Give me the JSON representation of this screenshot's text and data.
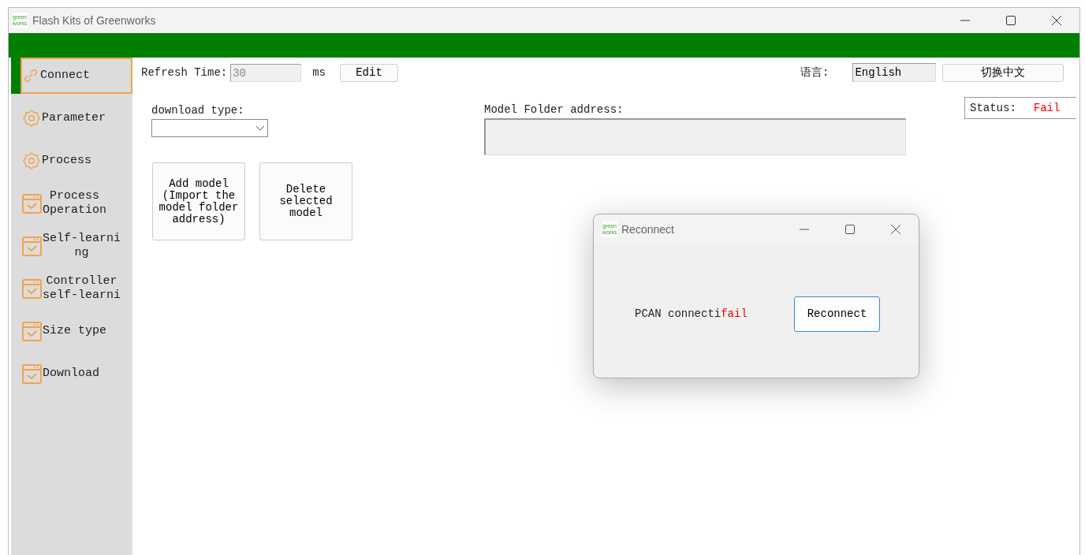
{
  "window": {
    "title": "Flash Kits of Greenworks",
    "logo": [
      "green",
      "works"
    ]
  },
  "sidebar": {
    "items": [
      {
        "kind": "link",
        "lines": [
          "Connect"
        ],
        "selected": true
      },
      {
        "kind": "gear",
        "lines": [
          "Parameter"
        ],
        "selected": false
      },
      {
        "kind": "gear",
        "lines": [
          "Process"
        ],
        "selected": false
      },
      {
        "kind": "calendar",
        "lines": [
          "Process",
          "Operation"
        ],
        "selected": false
      },
      {
        "kind": "calendar",
        "lines": [
          "Self-learni",
          "ng"
        ],
        "selected": false
      },
      {
        "kind": "calendar",
        "lines": [
          "Controller",
          "self-learni"
        ],
        "selected": false
      },
      {
        "kind": "calendar",
        "lines": [
          "Size type"
        ],
        "selected": false
      },
      {
        "kind": "calendar",
        "lines": [
          "Download"
        ],
        "selected": false
      }
    ]
  },
  "refresh": {
    "label": "Refresh Time:",
    "value": "30",
    "unit": "ms",
    "button": "Edit"
  },
  "language": {
    "label": "语言:",
    "value": "English",
    "button": "切换中文"
  },
  "download_type": {
    "label": "download type:"
  },
  "model_folder": {
    "label": "Model Folder address:"
  },
  "status": {
    "label": "Status:",
    "value": "Fail"
  },
  "buttons": [
    "Add model (Import the model folder address)",
    "Delete selected model"
  ],
  "dialog": {
    "title": "Reconnect",
    "logo": [
      "green",
      "works"
    ],
    "message": "PCAN connecti**fail**",
    "button": "Reconnect"
  }
}
